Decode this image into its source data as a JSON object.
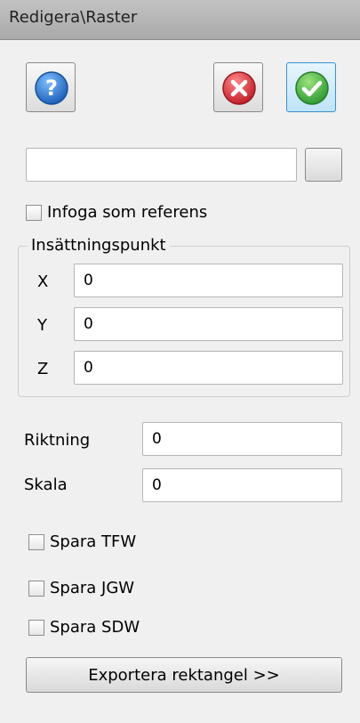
{
  "window": {
    "title": "Redigera\\Raster"
  },
  "toolbar": {
    "help_icon": "help-icon",
    "cancel_icon": "cancel-icon",
    "ok_icon": "ok-icon"
  },
  "file": {
    "value": ""
  },
  "options": {
    "insert_as_reference": "Infoga som referens"
  },
  "insertion_point": {
    "legend": "Insättningspunkt",
    "x_label": "X",
    "x_value": "0",
    "y_label": "Y",
    "y_value": "0",
    "z_label": "Z",
    "z_value": "0"
  },
  "direction": {
    "label": "Riktning",
    "value": "0"
  },
  "scale": {
    "label": "Skala",
    "value": "0"
  },
  "save": {
    "tfw": "Spara TFW",
    "jgw": "Spara JGW",
    "sdw": "Spara SDW"
  },
  "export": {
    "label": "Exportera rektangel >>"
  },
  "colors": {
    "help": "#2f7dd1",
    "cancel": "#d8343d",
    "ok": "#3fb34a"
  }
}
